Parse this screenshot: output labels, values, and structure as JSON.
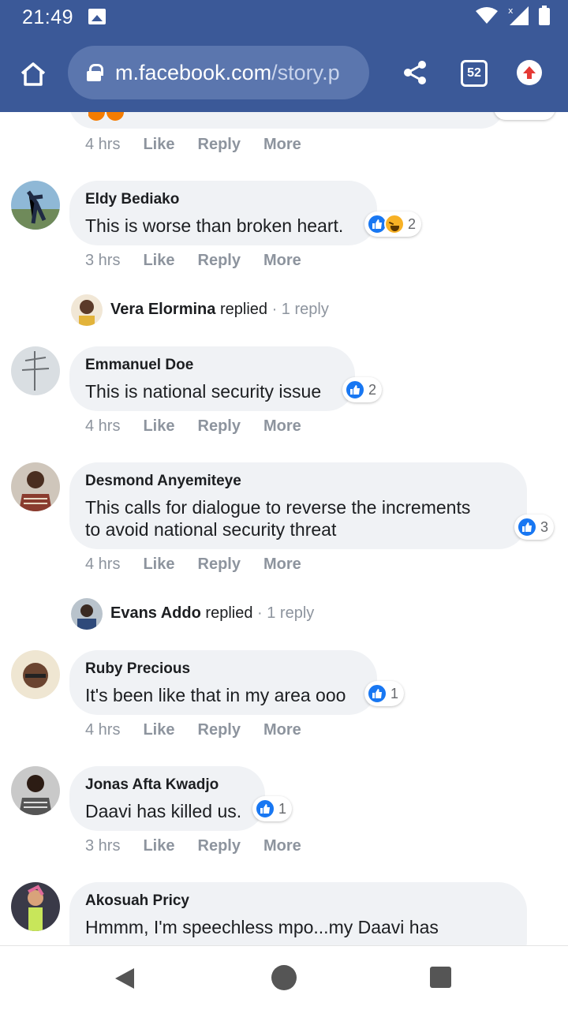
{
  "status_bar": {
    "time": "21:49"
  },
  "browser": {
    "url_host": "m.facebook.com",
    "url_path": "/story.p",
    "tab_count": "52"
  },
  "comments": [
    {
      "author": "",
      "text": "",
      "time": "4 hrs",
      "like": "Like",
      "reply": "Reply",
      "more": "More"
    },
    {
      "author": "Eldy Bediako",
      "text": "This is worse than broken heart.",
      "reaction_count": "2",
      "time": "3 hrs",
      "like": "Like",
      "reply": "Reply",
      "more": "More",
      "replied_name": "Vera Elormina",
      "replied_word": "replied",
      "replied_count": "· 1 reply"
    },
    {
      "author": "Emmanuel Doe",
      "text": "This is national security issue",
      "reaction_count": "2",
      "time": "4 hrs",
      "like": "Like",
      "reply": "Reply",
      "more": "More"
    },
    {
      "author": "Desmond Anyemiteye",
      "text_line1": "This calls for dialogue to reverse the increments",
      "text_line2": "to avoid national security threat",
      "reaction_count": "3",
      "time": "4 hrs",
      "like": "Like",
      "reply": "Reply",
      "more": "More",
      "replied_name": "Evans Addo",
      "replied_word": "replied",
      "replied_count": "· 1 reply"
    },
    {
      "author": "Ruby Precious",
      "text": "It's been like that in my area ooo",
      "reaction_count": "1",
      "time": "4 hrs",
      "like": "Like",
      "reply": "Reply",
      "more": "More"
    },
    {
      "author": "Jonas Afta Kwadjo",
      "text": "Daavi has killed us.",
      "reaction_count": "1",
      "time": "3 hrs",
      "like": "Like",
      "reply": "Reply",
      "more": "More"
    },
    {
      "author": "Akosuah Pricy",
      "text_line1": "Hmmm, I'm speechless mpo...my Daavi has"
    }
  ],
  "colors": {
    "brand": "#3b5998",
    "bubble": "#f0f2f5",
    "like_blue": "#1877f2",
    "muted_text": "#8d949e"
  }
}
